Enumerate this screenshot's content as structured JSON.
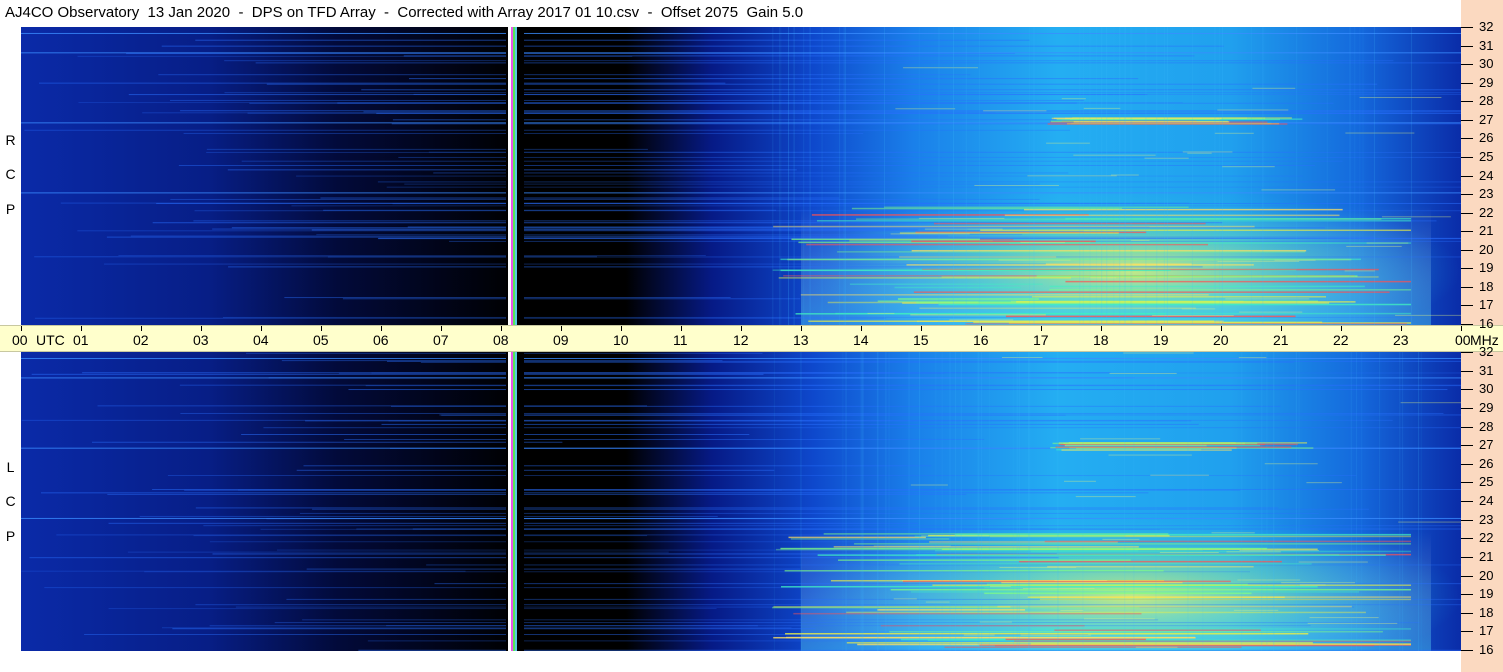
{
  "title": "AJ4CO Observatory  13 Jan 2020  -  DPS on TFD Array  -  Corrected with Array 2017 01 10.csv  -  Offset 2075  Gain 5.0",
  "chart_data": {
    "type": "heatmap",
    "panels": [
      {
        "label_letters": [
          "R",
          "C",
          "P"
        ]
      },
      {
        "label_letters": [
          "L",
          "C",
          "P"
        ]
      }
    ],
    "time_axis": {
      "ticks": [
        "00",
        "01",
        "02",
        "03",
        "04",
        "05",
        "06",
        "07",
        "08",
        "09",
        "10",
        "11",
        "12",
        "13",
        "14",
        "15",
        "16",
        "17",
        "18",
        "19",
        "20",
        "21",
        "22",
        "23",
        "00"
      ],
      "utc_label": "UTC",
      "mhz_label": "MHz",
      "range": [
        0,
        24
      ]
    },
    "freq_axis": {
      "ticks": [
        "32",
        "31",
        "30",
        "29",
        "28",
        "27",
        "26",
        "25",
        "24",
        "23",
        "22",
        "21",
        "20",
        "19",
        "18",
        "17",
        "16"
      ],
      "range": [
        16,
        32
      ]
    },
    "colors": {
      "background_dark": "#000000",
      "low": "#0a1a9a",
      "mid": "#1060e0",
      "high": "#20c8f0",
      "peak": "#e0f040",
      "hot": "#ff4040",
      "axis_time_bg": "#ffffcc",
      "axis_freq_bg": "#fbd9c0"
    }
  }
}
